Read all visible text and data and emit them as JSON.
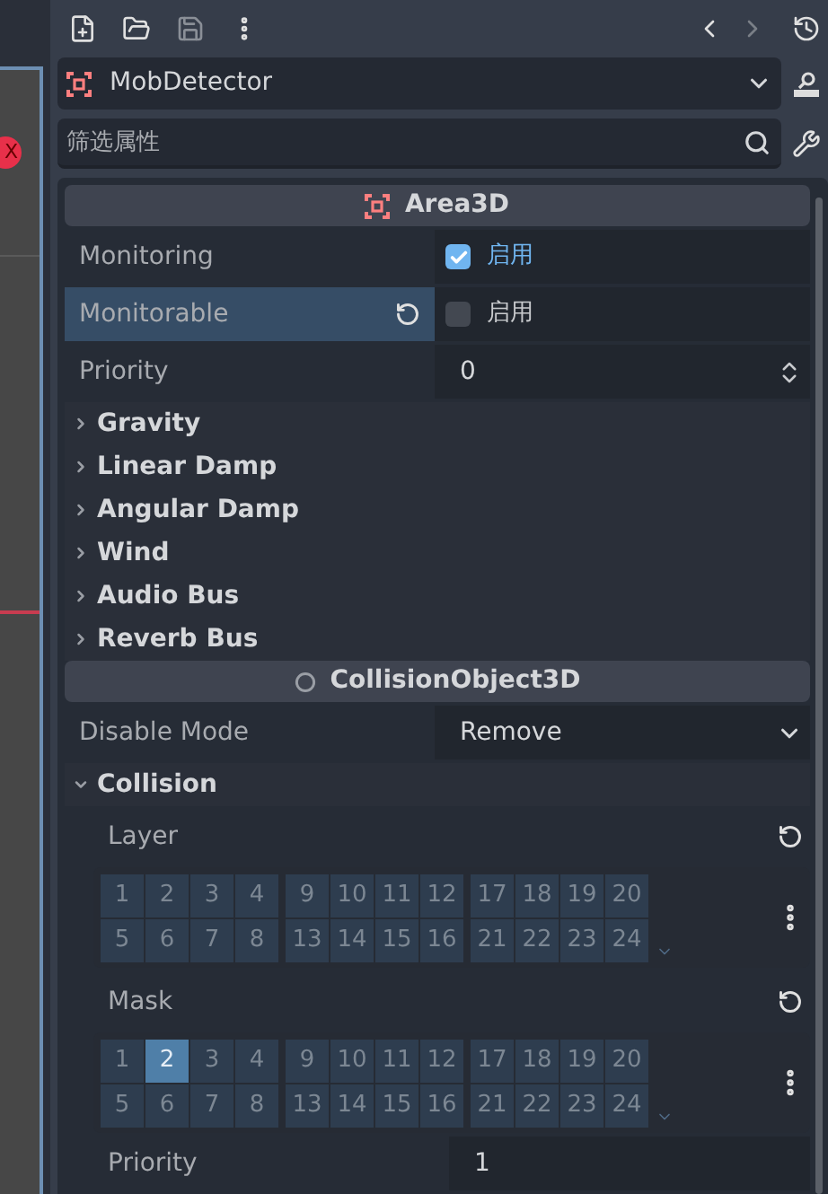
{
  "viewport_strip": {
    "close_badge": "X"
  },
  "node_selector": {
    "name": "MobDetector"
  },
  "filter": {
    "placeholder": "筛选属性"
  },
  "sections": [
    {
      "kind": "header",
      "title": "Area3D"
    },
    {
      "kind": "check",
      "label": "Monitoring",
      "checked": true,
      "value": "启用",
      "selected": false
    },
    {
      "kind": "check",
      "label": "Monitorable",
      "checked": false,
      "value": "启用",
      "selected": true
    },
    {
      "kind": "spin",
      "label": "Priority",
      "value": "0"
    },
    {
      "kind": "group",
      "label": "Gravity",
      "expanded": false
    },
    {
      "kind": "group",
      "label": "Linear Damp",
      "expanded": false
    },
    {
      "kind": "group",
      "label": "Angular Damp",
      "expanded": false
    },
    {
      "kind": "group",
      "label": "Wind",
      "expanded": false
    },
    {
      "kind": "group",
      "label": "Audio Bus",
      "expanded": false
    },
    {
      "kind": "group",
      "label": "Reverb Bus",
      "expanded": false
    },
    {
      "kind": "header",
      "title": "CollisionObject3D"
    },
    {
      "kind": "option",
      "label": "Disable Mode",
      "value": "Remove"
    },
    {
      "kind": "group",
      "label": "Collision",
      "expanded": true
    },
    {
      "kind": "layers",
      "label": "Layer",
      "bits": [
        {
          "label": "1",
          "selected": false
        },
        {
          "label": "2",
          "selected": false
        },
        {
          "label": "3",
          "selected": false
        },
        {
          "label": "4",
          "selected": false
        },
        {
          "label": "9",
          "selected": false
        },
        {
          "label": "10",
          "selected": false
        },
        {
          "label": "11",
          "selected": false
        },
        {
          "label": "12",
          "selected": false
        },
        {
          "label": "17",
          "selected": false
        },
        {
          "label": "18",
          "selected": false
        },
        {
          "label": "19",
          "selected": false
        },
        {
          "label": "20",
          "selected": false
        },
        {
          "label": "5",
          "selected": false
        },
        {
          "label": "6",
          "selected": false
        },
        {
          "label": "7",
          "selected": false
        },
        {
          "label": "8",
          "selected": false
        },
        {
          "label": "13",
          "selected": false
        },
        {
          "label": "14",
          "selected": false
        },
        {
          "label": "15",
          "selected": false
        },
        {
          "label": "16",
          "selected": false
        },
        {
          "label": "21",
          "selected": false
        },
        {
          "label": "22",
          "selected": false
        },
        {
          "label": "23",
          "selected": false
        },
        {
          "label": "24",
          "selected": false
        }
      ]
    },
    {
      "kind": "layers",
      "label": "Mask",
      "bits": [
        {
          "label": "1",
          "selected": false
        },
        {
          "label": "2",
          "selected": true
        },
        {
          "label": "3",
          "selected": false
        },
        {
          "label": "4",
          "selected": false
        },
        {
          "label": "9",
          "selected": false
        },
        {
          "label": "10",
          "selected": false
        },
        {
          "label": "11",
          "selected": false
        },
        {
          "label": "12",
          "selected": false
        },
        {
          "label": "17",
          "selected": false
        },
        {
          "label": "18",
          "selected": false
        },
        {
          "label": "19",
          "selected": false
        },
        {
          "label": "20",
          "selected": false
        },
        {
          "label": "5",
          "selected": false
        },
        {
          "label": "6",
          "selected": false
        },
        {
          "label": "7",
          "selected": false
        },
        {
          "label": "8",
          "selected": false
        },
        {
          "label": "13",
          "selected": false
        },
        {
          "label": "14",
          "selected": false
        },
        {
          "label": "15",
          "selected": false
        },
        {
          "label": "16",
          "selected": false
        },
        {
          "label": "21",
          "selected": false
        },
        {
          "label": "22",
          "selected": false
        },
        {
          "label": "23",
          "selected": false
        },
        {
          "label": "24",
          "selected": false
        }
      ]
    },
    {
      "kind": "number",
      "label": "Priority",
      "value": "1"
    }
  ]
}
